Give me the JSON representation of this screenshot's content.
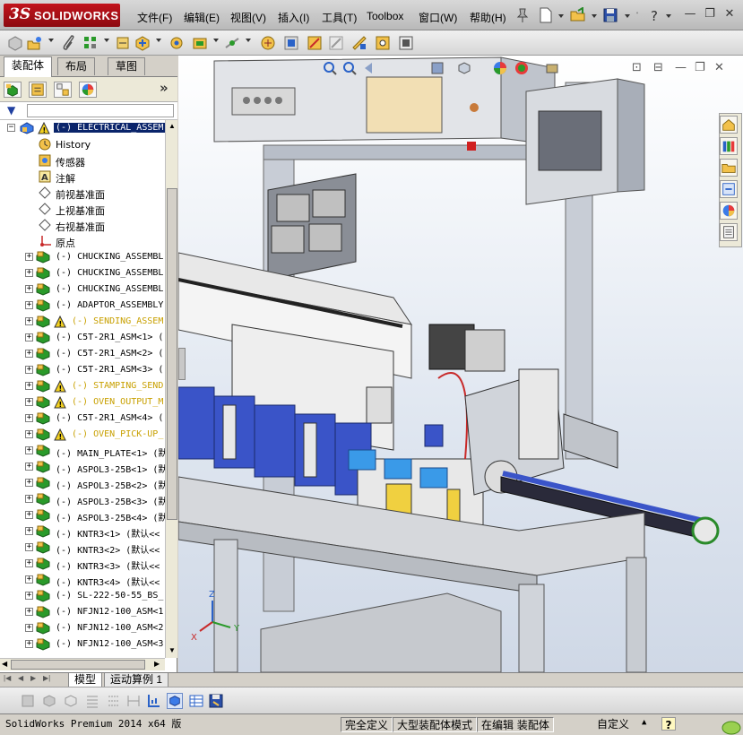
{
  "app": {
    "brand_prefix": "3S",
    "brand_name": "SOLIDWORKS"
  },
  "menu": [
    {
      "label": "文件(F)"
    },
    {
      "label": "编辑(E)"
    },
    {
      "label": "视图(V)"
    },
    {
      "label": "插入(I)"
    },
    {
      "label": "工具(T)"
    },
    {
      "label": "Toolbox"
    },
    {
      "label": "窗口(W)"
    },
    {
      "label": "帮助(H)"
    }
  ],
  "window_controls": {
    "minimize": "—",
    "restore": "❐",
    "close": "✕"
  },
  "panel_tabs": [
    {
      "label": "装配体"
    },
    {
      "label": "布局"
    },
    {
      "label": "草图"
    }
  ],
  "tree": {
    "root": "(-) ELECTRICAL_ASSEM",
    "features": [
      {
        "label": "History"
      },
      {
        "label": "传感器"
      },
      {
        "label": "注解"
      },
      {
        "label": "前视基准面"
      },
      {
        "label": "上视基准面"
      },
      {
        "label": "右视基准面"
      },
      {
        "label": "原点"
      }
    ],
    "components": [
      {
        "label": "(-) CHUCKING_ASSEMBL",
        "warn": false
      },
      {
        "label": "(-) CHUCKING_ASSEMBL",
        "warn": false
      },
      {
        "label": "(-) CHUCKING_ASSEMBL",
        "warn": false
      },
      {
        "label": "(-) ADAPTOR_ASSEMBLY",
        "warn": false
      },
      {
        "label": "(-) SENDING_ASSEM",
        "warn": true
      },
      {
        "label": "(-) C5T-2R1_ASM<1> (",
        "warn": false
      },
      {
        "label": "(-) C5T-2R1_ASM<2> (",
        "warn": false
      },
      {
        "label": "(-) C5T-2R1_ASM<3> (",
        "warn": false
      },
      {
        "label": "(-) STAMPING_SEND",
        "warn": true
      },
      {
        "label": "(-) OVEN_OUTPUT_M",
        "warn": true
      },
      {
        "label": "(-) C5T-2R1_ASM<4> (",
        "warn": false
      },
      {
        "label": "(-) OVEN_PICK-UP_",
        "warn": true
      },
      {
        "label": "(-) MAIN_PLATE<1> (默",
        "warn": false
      },
      {
        "label": "(-) ASPOL3-25B<1> (默",
        "warn": false
      },
      {
        "label": "(-) ASPOL3-25B<2> (默",
        "warn": false
      },
      {
        "label": "(-) ASPOL3-25B<3> (默",
        "warn": false
      },
      {
        "label": "(-) ASPOL3-25B<4> (默",
        "warn": false
      },
      {
        "label": "(-) KNTR3<1> (默认<<",
        "warn": false
      },
      {
        "label": "(-) KNTR3<2> (默认<<",
        "warn": false
      },
      {
        "label": "(-) KNTR3<3> (默认<<",
        "warn": false
      },
      {
        "label": "(-) KNTR3<4> (默认<<",
        "warn": false
      },
      {
        "label": "(-) SL-222-50-55_BS_",
        "warn": false
      },
      {
        "label": "(-) NFJN12-100_ASM<1",
        "warn": false
      },
      {
        "label": "(-) NFJN12-100_ASM<2",
        "warn": false
      },
      {
        "label": "(-) NFJN12-100_ASM<3",
        "warn": false
      }
    ]
  },
  "bottom_tabs": [
    {
      "label": "模型"
    },
    {
      "label": "运动算例 1"
    }
  ],
  "status": {
    "product": "SolidWorks Premium 2014 x64 版",
    "constraint": "完全定义",
    "mode": "大型装配体模式",
    "editing": "在编辑 装配体",
    "units": "自定义",
    "help": "?"
  },
  "triad": {
    "x": "X",
    "y": "Y",
    "z": "Z"
  },
  "colors": {
    "brand_red": "#c2141c",
    "selection": "#0a246a",
    "warning": "#c8a000",
    "machine_blue": "#3a54c8"
  }
}
